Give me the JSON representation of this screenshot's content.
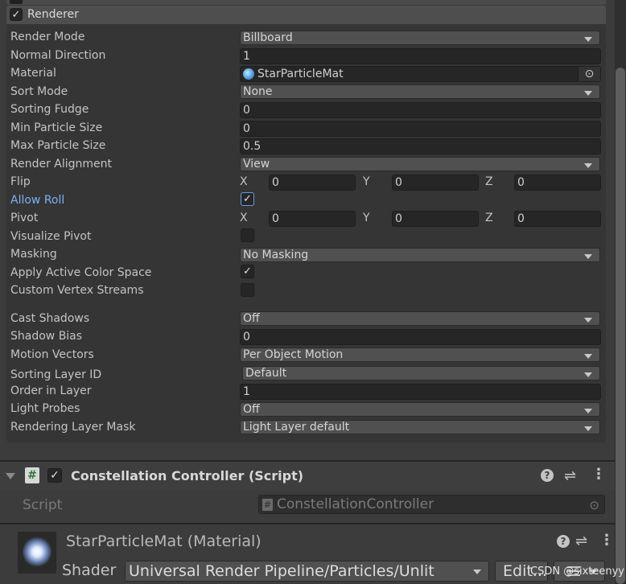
{
  "renderer_module": {
    "title": "Renderer",
    "enabled": true,
    "rows": {
      "render_mode": {
        "label": "Render Mode",
        "value": "Billboard"
      },
      "normal_direction": {
        "label": "Normal Direction",
        "value": "1"
      },
      "material": {
        "label": "Material",
        "value": "StarParticleMat"
      },
      "sort_mode": {
        "label": "Sort Mode",
        "value": "None"
      },
      "sorting_fudge": {
        "label": "Sorting Fudge",
        "value": "0"
      },
      "min_particle_size": {
        "label": "Min Particle Size",
        "value": "0"
      },
      "max_particle_size": {
        "label": "Max Particle Size",
        "value": "0.5"
      },
      "render_alignment": {
        "label": "Render Alignment",
        "value": "View"
      },
      "flip": {
        "label": "Flip",
        "x_label": "X",
        "x": "0",
        "y_label": "Y",
        "y": "0",
        "z_label": "Z",
        "z": "0"
      },
      "allow_roll": {
        "label": "Allow Roll",
        "checked": true
      },
      "pivot": {
        "label": "Pivot",
        "x_label": "X",
        "x": "0",
        "y_label": "Y",
        "y": "0",
        "z_label": "Z",
        "z": "0"
      },
      "visualize_pivot": {
        "label": "Visualize Pivot",
        "checked": false
      },
      "masking": {
        "label": "Masking",
        "value": "No Masking"
      },
      "apply_active_color_space": {
        "label": "Apply Active Color Space",
        "checked": true
      },
      "custom_vertex_streams": {
        "label": "Custom Vertex Streams",
        "checked": false
      },
      "cast_shadows": {
        "label": "Cast Shadows",
        "value": "Off"
      },
      "shadow_bias": {
        "label": "Shadow Bias",
        "value": "0"
      },
      "motion_vectors": {
        "label": "Motion Vectors",
        "value": "Per Object Motion"
      },
      "sorting_layer_id": {
        "label": "Sorting Layer ID",
        "value": "Default"
      },
      "order_in_layer": {
        "label": "Order in Layer",
        "value": "1"
      },
      "light_probes": {
        "label": "Light Probes",
        "value": "Off"
      },
      "rendering_layer_mask": {
        "label": "Rendering Layer Mask",
        "value": "Light Layer default"
      }
    }
  },
  "script_component": {
    "title": "Constellation Controller (Script)",
    "enabled": true,
    "script_label": "Script",
    "script_value": "ConstellationController",
    "script_icon_glyph": "#"
  },
  "material_component": {
    "title": "StarParticleMat (Material)",
    "shader_label": "Shader",
    "shader_value": "Universal Render Pipeline/Particles/Unlit",
    "edit_label": "Edit..."
  },
  "icons": {
    "check": "✓",
    "help": "?",
    "kebab": "⋮",
    "presets": "⇌",
    "object_picker": "⊙"
  },
  "watermark": "CSDN @sixteenyy",
  "colors": {
    "accent_label": "#7bb0ef",
    "panel_bg": "#3c3c3c",
    "field_bg": "#262626",
    "dropdown_bg": "#505050"
  }
}
